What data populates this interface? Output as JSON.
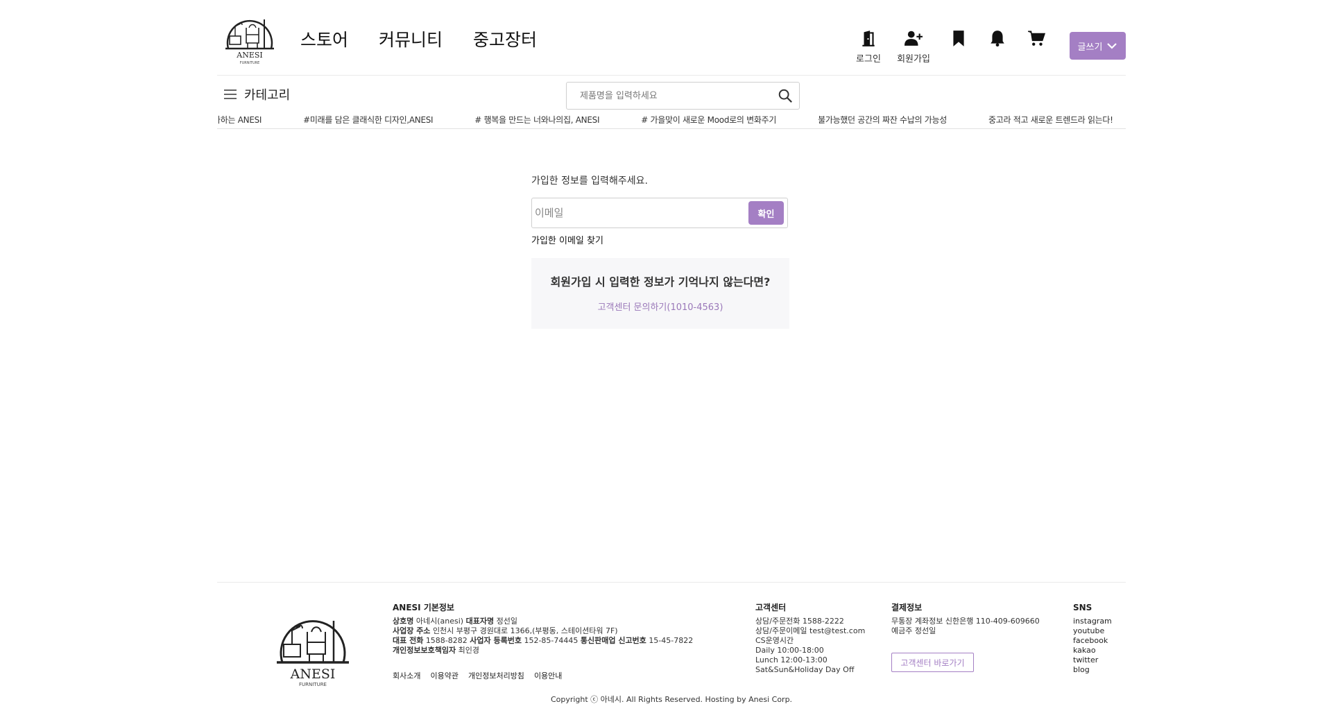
{
  "brand": {
    "name": "ANESI",
    "sub": "FURNITURE",
    "accent": "#a47fc4"
  },
  "nav": [
    "스토어",
    "커뮤니티",
    "중고장터"
  ],
  "header_icons": [
    {
      "icon": "door-icon",
      "label": "로그인"
    },
    {
      "icon": "add-user-icon",
      "label": "회원가입"
    },
    {
      "icon": "bookmark-icon",
      "label": ""
    },
    {
      "icon": "bell-icon",
      "label": ""
    },
    {
      "icon": "cart-icon",
      "label": ""
    }
  ],
  "write_button": "글쓰기",
  "category_label": "카테고리",
  "search": {
    "placeholder": "제품명을 입력하세요"
  },
  "ticker": [
    "가하는 ANESI",
    "#미래를 담은 클래식한 디자인,ANESI",
    "# 행복을 만드는 너와나의집, ANESI",
    "# 가을맞이 새로운 Mood로의 변화주기",
    "불가능했던 공간의 짜잔 수납의 가능성",
    "중고라 적고 새로운 트렌드라 읽는다!"
  ],
  "main": {
    "title": "가입한 정보를 입력해주세요.",
    "email_placeholder": "이메일",
    "confirm": "확인",
    "find_link": "가입한 이메일 찾기",
    "help_question": "회원가입 시 입력한 정보가 기억나지 않는다면?",
    "help_link": "고객센터 문의하기(1010-4563)"
  },
  "footer": {
    "info_title": "ANESI 기본정보",
    "info": {
      "l1_k1": "상호명",
      "l1_v1": "아네시(anesi)",
      "l1_k2": "대표자명",
      "l1_v2": "정선일",
      "l2_k1": "사업장 주소",
      "l2_v1": "인천시 부평구 경원대로 1366,(부평동, 스테이션타워 7F)",
      "l3_k1": "대표 전화",
      "l3_v1": "1588-8282",
      "l3_k2": "사업자 등록번호",
      "l3_v2": "152-85-74445",
      "l3_k3": "통신판매업 신고번호",
      "l3_v3": "15-45-7822",
      "l4_k1": "개인정보보호책임자",
      "l4_v1": "최인경"
    },
    "links": [
      "회사소개",
      "이용약관",
      "개인정보처리방침",
      "이용안내"
    ],
    "cs_title": "고객센터",
    "cs_lines": [
      "상담/주문전화 1588-2222",
      "상담/주문이메일 test@test.com",
      "CS운영시간",
      "Daily 10:00-18:00",
      "Lunch 12:00-13:00",
      "Sat&Sun&Holiday Day Off"
    ],
    "pay_title": "결제정보",
    "pay_lines": [
      "무통장 계좌정보 신한은행 110-409-609660",
      "예금주 정선일"
    ],
    "pay_button": "고객센터 바로가기",
    "sns_title": "SNS",
    "sns": [
      "instagram",
      "youtube",
      "facebook",
      "kakao",
      "twitter",
      "blog"
    ],
    "copyright": "Copyright ⓒ 아네시. All Rights Reserved. Hosting by Anesi Corp."
  }
}
